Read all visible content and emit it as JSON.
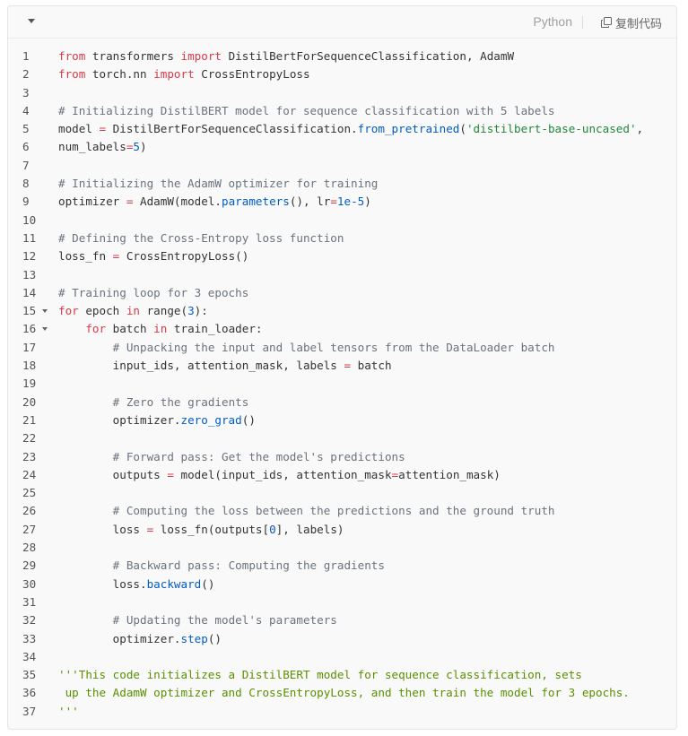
{
  "toolbar": {
    "language": "Python",
    "copy_label": "复制代码"
  },
  "code_lines": [
    {
      "n": "1",
      "tokens": [
        [
          "kw",
          "from"
        ],
        [
          "t",
          " transformers "
        ],
        [
          "kw",
          "import"
        ],
        [
          "t",
          " DistilBertForSequenceClassification, AdamW"
        ]
      ]
    },
    {
      "n": "2",
      "tokens": [
        [
          "kw",
          "from"
        ],
        [
          "t",
          " torch.nn "
        ],
        [
          "kw",
          "import"
        ],
        [
          "t",
          " CrossEntropyLoss"
        ]
      ]
    },
    {
      "n": "3",
      "tokens": []
    },
    {
      "n": "4",
      "tokens": [
        [
          "cm",
          "# Initializing DistilBERT model for sequence classification with 5 labels"
        ]
      ]
    },
    {
      "n": "5",
      "tokens": [
        [
          "t",
          "model "
        ],
        [
          "op",
          "="
        ],
        [
          "t",
          " DistilBertForSequenceClassification."
        ],
        [
          "fn",
          "from_pretrained"
        ],
        [
          "t",
          "("
        ],
        [
          "str",
          "'distilbert-base-uncased'"
        ],
        [
          "t",
          ","
        ]
      ]
    },
    {
      "n": "6",
      "tokens": [
        [
          "t",
          "num_labels"
        ],
        [
          "op",
          "="
        ],
        [
          "num",
          "5"
        ],
        [
          "t",
          ")"
        ]
      ]
    },
    {
      "n": "7",
      "tokens": []
    },
    {
      "n": "8",
      "tokens": [
        [
          "cm",
          "# Initializing the AdamW optimizer for training"
        ]
      ]
    },
    {
      "n": "9",
      "tokens": [
        [
          "t",
          "optimizer "
        ],
        [
          "op",
          "="
        ],
        [
          "t",
          " AdamW(model."
        ],
        [
          "fn",
          "parameters"
        ],
        [
          "t",
          "(), lr"
        ],
        [
          "op",
          "="
        ],
        [
          "num",
          "1e-5"
        ],
        [
          "t",
          ")"
        ]
      ]
    },
    {
      "n": "10",
      "tokens": []
    },
    {
      "n": "11",
      "tokens": [
        [
          "cm",
          "# Defining the Cross-Entropy loss function"
        ]
      ]
    },
    {
      "n": "12",
      "tokens": [
        [
          "t",
          "loss_fn "
        ],
        [
          "op",
          "="
        ],
        [
          "t",
          " CrossEntropyLoss()"
        ]
      ]
    },
    {
      "n": "13",
      "tokens": []
    },
    {
      "n": "14",
      "tokens": [
        [
          "cm",
          "# Training loop for 3 epochs"
        ]
      ]
    },
    {
      "n": "15",
      "fold": true,
      "tokens": [
        [
          "kw",
          "for"
        ],
        [
          "t",
          " epoch "
        ],
        [
          "kw",
          "in"
        ],
        [
          "t",
          " range("
        ],
        [
          "num",
          "3"
        ],
        [
          "t",
          "):"
        ]
      ]
    },
    {
      "n": "16",
      "fold": true,
      "tokens": [
        [
          "t",
          "    "
        ],
        [
          "kw",
          "for"
        ],
        [
          "t",
          " batch "
        ],
        [
          "kw",
          "in"
        ],
        [
          "t",
          " train_loader:"
        ]
      ]
    },
    {
      "n": "17",
      "tokens": [
        [
          "t",
          "        "
        ],
        [
          "cm",
          "# Unpacking the input and label tensors from the DataLoader batch"
        ]
      ]
    },
    {
      "n": "18",
      "tokens": [
        [
          "t",
          "        input_ids, attention_mask, labels "
        ],
        [
          "op",
          "="
        ],
        [
          "t",
          " batch"
        ]
      ]
    },
    {
      "n": "19",
      "tokens": []
    },
    {
      "n": "20",
      "tokens": [
        [
          "t",
          "        "
        ],
        [
          "cm",
          "# Zero the gradients"
        ]
      ]
    },
    {
      "n": "21",
      "tokens": [
        [
          "t",
          "        optimizer."
        ],
        [
          "fn",
          "zero_grad"
        ],
        [
          "t",
          "()"
        ]
      ]
    },
    {
      "n": "22",
      "tokens": []
    },
    {
      "n": "23",
      "tokens": [
        [
          "t",
          "        "
        ],
        [
          "cm",
          "# Forward pass: Get the model's predictions"
        ]
      ]
    },
    {
      "n": "24",
      "tokens": [
        [
          "t",
          "        outputs "
        ],
        [
          "op",
          "="
        ],
        [
          "t",
          " model(input_ids, attention_mask"
        ],
        [
          "op",
          "="
        ],
        [
          "t",
          "attention_mask)"
        ]
      ]
    },
    {
      "n": "25",
      "tokens": []
    },
    {
      "n": "26",
      "tokens": [
        [
          "t",
          "        "
        ],
        [
          "cm",
          "# Computing the loss between the predictions and the ground truth"
        ]
      ]
    },
    {
      "n": "27",
      "tokens": [
        [
          "t",
          "        loss "
        ],
        [
          "op",
          "="
        ],
        [
          "t",
          " loss_fn(outputs["
        ],
        [
          "num",
          "0"
        ],
        [
          "t",
          "], labels)"
        ]
      ]
    },
    {
      "n": "28",
      "tokens": []
    },
    {
      "n": "29",
      "tokens": [
        [
          "t",
          "        "
        ],
        [
          "cm",
          "# Backward pass: Computing the gradients"
        ]
      ]
    },
    {
      "n": "30",
      "tokens": [
        [
          "t",
          "        loss."
        ],
        [
          "fn",
          "backward"
        ],
        [
          "t",
          "()"
        ]
      ]
    },
    {
      "n": "31",
      "tokens": []
    },
    {
      "n": "32",
      "tokens": [
        [
          "t",
          "        "
        ],
        [
          "cm",
          "# Updating the model's parameters"
        ]
      ]
    },
    {
      "n": "33",
      "tokens": [
        [
          "t",
          "        optimizer."
        ],
        [
          "fn",
          "step"
        ],
        [
          "t",
          "()"
        ]
      ]
    },
    {
      "n": "34",
      "tokens": []
    },
    {
      "n": "35",
      "tokens": [
        [
          "doc",
          "'''This code initializes a DistilBERT model for sequence classification, sets"
        ]
      ]
    },
    {
      "n": "36",
      "tokens": [
        [
          "doc",
          " up the AdamW optimizer and CrossEntropyLoss, and then train the model for 3 epochs."
        ]
      ]
    },
    {
      "n": "37",
      "tokens": [
        [
          "doc",
          "'''"
        ]
      ]
    }
  ]
}
